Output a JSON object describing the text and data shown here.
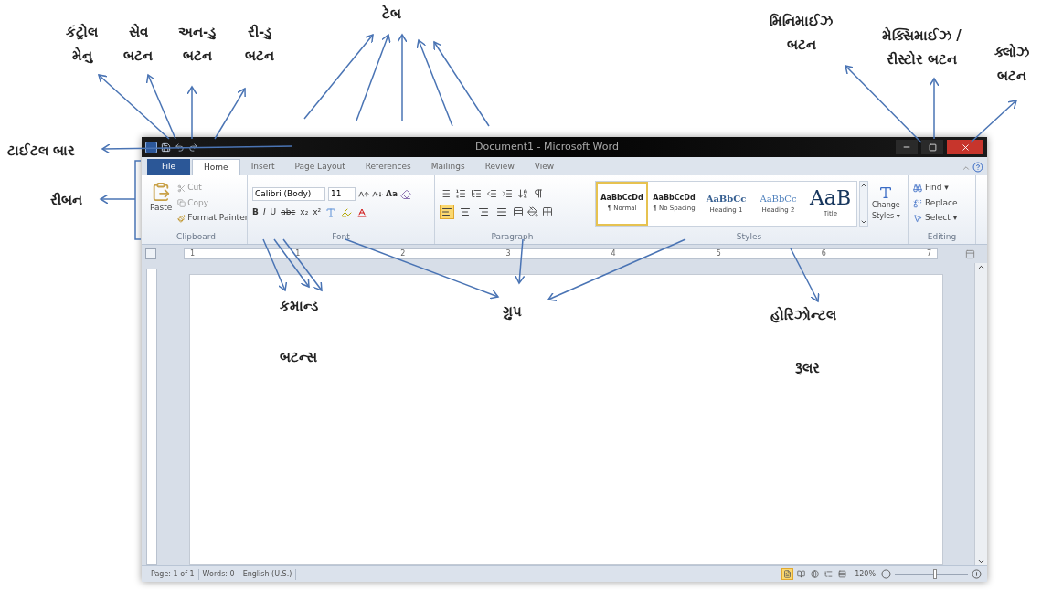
{
  "annotations": [
    {
      "lines": [
        "કંટ્રોલ",
        "મેનુ"
      ]
    },
    {
      "lines": [
        "સેવ",
        "બટન"
      ]
    },
    {
      "lines": [
        "અન-ડુ",
        "બટન"
      ]
    },
    {
      "lines": [
        "રી-ડુ",
        "બટન"
      ]
    },
    {
      "lines": [
        "ટેબ"
      ]
    },
    {
      "lines": [
        "મિનિમાઈઝ",
        "બટન"
      ]
    },
    {
      "lines": [
        "મેક્સિમાઈઝ /",
        "રીસ્ટોર બટન"
      ]
    },
    {
      "lines": [
        "ક્લોઝ",
        "બટન"
      ]
    },
    {
      "lines": [
        "ટાઈટલ બાર"
      ]
    },
    {
      "lines": [
        "રીબન"
      ]
    },
    {
      "lines": [
        "કમાન્ડ"
      ]
    },
    {
      "lines": [
        "બટન્સ"
      ]
    },
    {
      "lines": [
        "ગ્રુપ"
      ]
    },
    {
      "lines": [
        "હોરિઝોન્ટલ"
      ]
    },
    {
      "lines": [
        "રૂલર"
      ]
    }
  ],
  "window": {
    "title": "Document1 - Microsoft Word"
  },
  "tabs": [
    {
      "label": "File",
      "kind": "file",
      "selected": false
    },
    {
      "label": "Home",
      "kind": "tab",
      "selected": true
    },
    {
      "label": "Insert",
      "kind": "tab",
      "selected": false
    },
    {
      "label": "Page Layout",
      "kind": "tab",
      "selected": false
    },
    {
      "label": "References",
      "kind": "tab",
      "selected": false
    },
    {
      "label": "Mailings",
      "kind": "tab",
      "selected": false
    },
    {
      "label": "Review",
      "kind": "tab",
      "selected": false
    },
    {
      "label": "View",
      "kind": "tab",
      "selected": false
    }
  ],
  "clipboard": {
    "paste": "Paste",
    "cut": "Cut",
    "copy": "Copy",
    "format_painter": "Format Painter",
    "group_label": "Clipboard"
  },
  "font": {
    "family": "Calibri (Body)",
    "size": "11",
    "case_button": "Aa",
    "commands": [
      "B",
      "I",
      "U",
      "abc",
      "x₂",
      "x²"
    ],
    "group_label": "Font"
  },
  "paragraph": {
    "alignments": [
      {
        "kind": "left",
        "selected": true
      },
      {
        "kind": "center",
        "selected": false
      },
      {
        "kind": "right",
        "selected": false
      },
      {
        "kind": "justify",
        "selected": false
      }
    ],
    "group_label": "Paragraph"
  },
  "styles": {
    "items": [
      {
        "preview": "AaBbCcDd",
        "name": "¶ Normal",
        "kind": "body",
        "selected": true
      },
      {
        "preview": "AaBbCcDd",
        "name": "¶ No Spacing",
        "kind": "body",
        "selected": false
      },
      {
        "preview": "AaBbCc",
        "name": "Heading 1",
        "kind": "heading",
        "selected": false
      },
      {
        "preview": "AaBbCc",
        "name": "Heading 2",
        "kind": "subheading",
        "selected": false
      },
      {
        "preview": "AaB",
        "name": "Title",
        "kind": "title",
        "selected": false
      }
    ],
    "change_styles": [
      "Change",
      "Styles ▾"
    ],
    "group_label": "Styles"
  },
  "editing": {
    "items": [
      "Find ▾",
      "Replace",
      "Select ▾"
    ],
    "group_label": "Editing"
  },
  "ruler": {
    "labels": [
      "1",
      "1",
      "2",
      "3",
      "4",
      "5",
      "6",
      "7"
    ]
  },
  "status_bar": {
    "page": "Page: 1 of 1",
    "words": "Words: 0",
    "language": "English (U.S.)",
    "views": [
      {
        "kind": "print",
        "selected": true
      },
      {
        "kind": "reading",
        "selected": false
      },
      {
        "kind": "web",
        "selected": false
      },
      {
        "kind": "outline",
        "selected": false
      },
      {
        "kind": "draft",
        "selected": false
      }
    ],
    "zoom": "120%",
    "zoom_slider": {
      "level": 0.55
    }
  }
}
